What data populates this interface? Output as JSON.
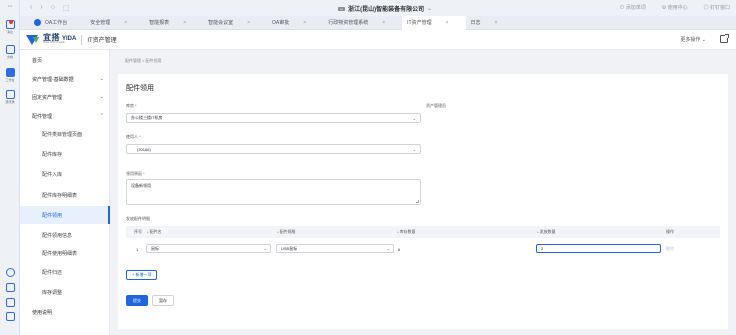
{
  "dock": {
    "items": [
      {
        "label": "消息",
        "icon": "bell-icon"
      },
      {
        "label": "文档",
        "icon": "document-icon"
      },
      {
        "label": "工作台",
        "icon": "grid-icon"
      },
      {
        "label": "通讯录",
        "icon": "contacts-icon"
      }
    ]
  },
  "titlebar": {
    "nav": [
      "‹",
      "›",
      "○",
      "⬚"
    ],
    "tag": "•••",
    "company": "浙江(昆山)智能装备有限公司",
    "company_chevron": "⌄",
    "right": [
      "⊙ 添加单词",
      "⚙ 使用中心",
      "◎ 钉钉窗口"
    ]
  },
  "tabs": [
    {
      "label": "OA工作台"
    },
    {
      "label": "安全管理"
    },
    {
      "label": "智能报表"
    },
    {
      "label": "智能会议室"
    },
    {
      "label": "OA审批"
    },
    {
      "label": "行政物资管理系统"
    },
    {
      "label": "IT资产管理"
    },
    {
      "label": "日志"
    }
  ],
  "header": {
    "logo_cn": "宜搭",
    "logo_en": "YIDA",
    "logo_sub": "Made With Dingtalk",
    "app_title": "IT资产管理",
    "more_ops": "更多操作",
    "more_chevron": "⌄"
  },
  "sidemenu": {
    "items": [
      {
        "label": "首页",
        "type": "top",
        "chevron": ""
      },
      {
        "label": "资产管理-基础数据",
        "type": "top",
        "chevron": "⌄"
      },
      {
        "label": "固定资产管理",
        "type": "top",
        "chevron": "⌄"
      },
      {
        "label": "配件管理",
        "type": "top",
        "chevron": "⌃"
      },
      {
        "label": "配件类目管理页面",
        "type": "sub",
        "chevron": ""
      },
      {
        "label": "配件库存",
        "type": "sub",
        "chevron": ""
      },
      {
        "label": "配件入库",
        "type": "sub",
        "chevron": ""
      },
      {
        "label": "配件库存明细表",
        "type": "sub",
        "chevron": ""
      },
      {
        "label": "配件领用",
        "type": "sub",
        "chevron": "",
        "active": true
      },
      {
        "label": "配件领用信息",
        "type": "sub",
        "chevron": ""
      },
      {
        "label": "配件使用明细表",
        "type": "sub",
        "chevron": ""
      },
      {
        "label": "配件归还",
        "type": "sub",
        "chevron": ""
      },
      {
        "label": "库存调整",
        "type": "sub",
        "chevron": ""
      },
      {
        "label": "使用说明",
        "type": "top",
        "chevron": ""
      }
    ]
  },
  "breadcrumb": "配件管理 > 配件领用",
  "form": {
    "title": "配件领用",
    "campus_label": "库房",
    "campus_value": "办公楼三楼IT机房",
    "asset_status_label": "资产管理员",
    "user_label": "使用人",
    "user_value": "(20166)",
    "reason_label": "领用原因",
    "reason_value": "设备新领用",
    "detail_label": "发放配件明细",
    "columns": [
      "序号",
      "配件名",
      "配件规格",
      "库存数量",
      "发放数量",
      "操作"
    ],
    "rows": [
      {
        "index": "1",
        "name": "鼠标",
        "spec": "USB鼠标",
        "stock": "6",
        "qty": "2",
        "action": "删除"
      }
    ],
    "add_row": "+ 新增一项",
    "submit": "提交",
    "save_draft": "暂存"
  },
  "colors": {
    "accent": "#1f64e0",
    "active_bg": "#e8f0fe"
  }
}
